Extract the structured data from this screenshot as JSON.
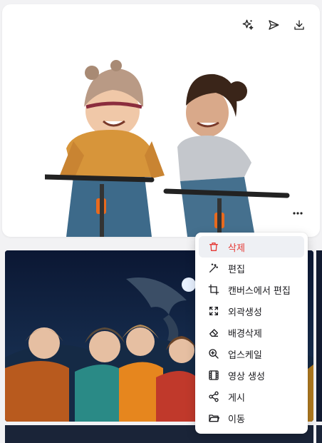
{
  "toolbar": {
    "icons": [
      "sparkle-icon",
      "send-icon",
      "download-icon"
    ]
  },
  "menu": {
    "items": [
      {
        "label": "삭제",
        "icon": "trash-icon",
        "danger": true
      },
      {
        "label": "편집",
        "icon": "magic-wand-icon"
      },
      {
        "label": "캔버스에서 편집",
        "icon": "crop-icon"
      },
      {
        "label": "외곽생성",
        "icon": "expand-icon"
      },
      {
        "label": "배경삭제",
        "icon": "eraser-icon"
      },
      {
        "label": "업스케일",
        "icon": "zoom-in-icon"
      },
      {
        "label": "영상 생성",
        "icon": "film-icon"
      },
      {
        "label": "게시",
        "icon": "share-icon"
      },
      {
        "label": "이동",
        "icon": "folder-icon"
      }
    ]
  },
  "colors": {
    "danger": "#e53935",
    "active_bg": "#eef0f4",
    "text": "#1b1b1f"
  }
}
